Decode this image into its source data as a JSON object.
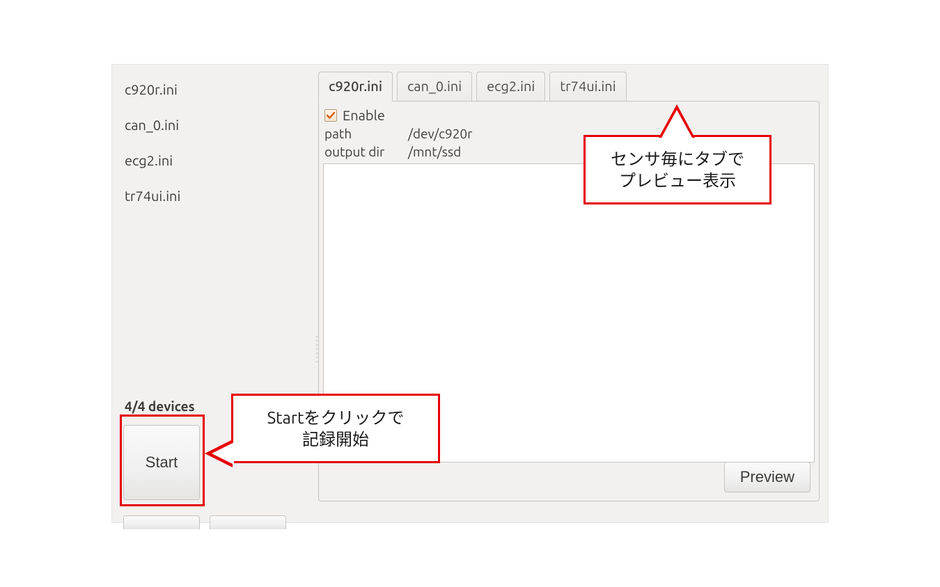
{
  "sidebar": {
    "items": [
      {
        "label": "c920r.ini"
      },
      {
        "label": "can_0.ini"
      },
      {
        "label": "ecg2.ini"
      },
      {
        "label": "tr74ui.ini"
      }
    ],
    "devices_status": "4/4 devices",
    "start_label": "Start"
  },
  "tabs": [
    {
      "label": "c920r.ini",
      "active": true
    },
    {
      "label": "can_0.ini",
      "active": false
    },
    {
      "label": "ecg2.ini",
      "active": false
    },
    {
      "label": "tr74ui.ini",
      "active": false
    }
  ],
  "tab_content": {
    "enable_label": "Enable",
    "enable_checked": true,
    "rows": [
      {
        "k": "path",
        "v": "/dev/c920r"
      },
      {
        "k": "output dir",
        "v": "/mnt/ssd"
      }
    ]
  },
  "preview_button_label": "Preview",
  "callouts": {
    "tabs": {
      "line1": "センサ毎にタブで",
      "line2": "プレビュー表示"
    },
    "start": {
      "line1": "Startをクリックで",
      "line2": "記録開始"
    }
  }
}
